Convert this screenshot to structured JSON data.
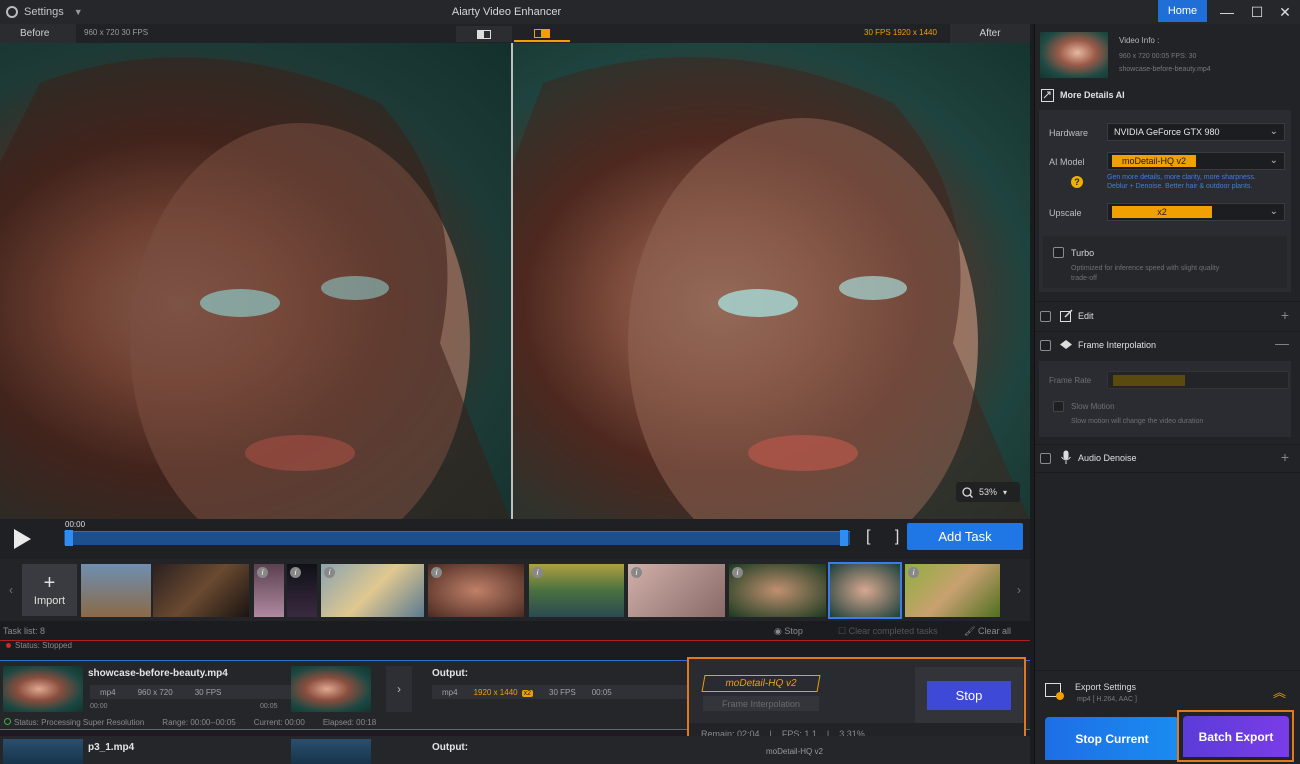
{
  "titlebar": {
    "settings_label": "Settings",
    "app_title": "Aiarty Video Enhancer",
    "home_label": "Home",
    "minimize": "—",
    "maximize": "☐",
    "close": "✕"
  },
  "preview": {
    "before_label": "Before",
    "before_info": "960 x 720  30 FPS",
    "after_info": "30 FPS   1920 x 1440",
    "after_label": "After",
    "zoom": "53%"
  },
  "timeline": {
    "current_time": "00:00",
    "add_task_label": "Add Task",
    "brackets": "[ ]"
  },
  "strip": {
    "import_label": "Import",
    "info_glyph": "i"
  },
  "tasklist": {
    "label": "Task list:  8",
    "stop_label": "Stop",
    "clear_completed_label": "Clear completed tasks",
    "clear_all_label": "Clear all",
    "status": "Status: Stopped"
  },
  "task1": {
    "name": "showcase-before-beauty.mp4",
    "format": "mp4",
    "resolution": "960 x 720",
    "fps": "30 FPS",
    "time_start": "00:00",
    "time_end": "00:05",
    "output_label": "Output:",
    "out_format": "mp4",
    "out_resolution": "1920 x 1440",
    "out_badge": "x2",
    "out_fps": "30 FPS",
    "out_duration": "00:05",
    "status": "Status: Processing Super Resolution",
    "range": "Range: 00:00--00:05",
    "current": "Current: 00:00",
    "elapsed": "Elapsed: 00:18"
  },
  "processing": {
    "model": "moDetail-HQ  v2",
    "frame_interp": "Frame Interpolation",
    "stop_label": "Stop",
    "remain": "Remain:  02:04",
    "fps": "FPS:  1.1",
    "percent": "3.31%"
  },
  "task2": {
    "name": "p3_1.mp4",
    "output_label": "Output:",
    "model": "moDetail-HQ  v2"
  },
  "panel": {
    "video_info_title": "Video Info :",
    "video_info_line": "960 x 720  00:05  FPS: 30",
    "video_info_file": "showcase-before-beauty.mp4",
    "more_details": "More Details AI",
    "hardware_label": "Hardware",
    "hardware_value": "NVIDIA GeForce GTX 980",
    "ai_model_label": "AI Model",
    "ai_model_value": "moDetail-HQ  v2",
    "ai_hint1": "Gen more details, more clarity, more sharpness.",
    "ai_hint2": "Deblur + Denoise. Better hair & outdoor plants.",
    "upscale_label": "Upscale",
    "upscale_value": "x2",
    "turbo_label": "Turbo",
    "turbo_desc1": "Optimized for inference speed with slight quality",
    "turbo_desc2": "trade-off",
    "edit_label": "Edit",
    "frame_interp_label": "Frame Interpolation",
    "frame_rate_label": "Frame Rate",
    "slow_motion_label": "Slow Motion",
    "slow_motion_desc": "Slow motion will change the video duration",
    "audio_denoise_label": "Audio Denoise",
    "export_settings_label": "Export Settings",
    "export_settings_value": "mp4 [ H.264, AAC ]",
    "stop_current_label": "Stop Current",
    "batch_export_label": "Batch Export",
    "plus": "+",
    "minus": "—",
    "question": "?"
  },
  "colors": {
    "accent_blue": "#1f77e6",
    "accent_orange": "#f0a000",
    "highlight_border": "#e07a20",
    "stop_purple": "#3f49d8"
  }
}
